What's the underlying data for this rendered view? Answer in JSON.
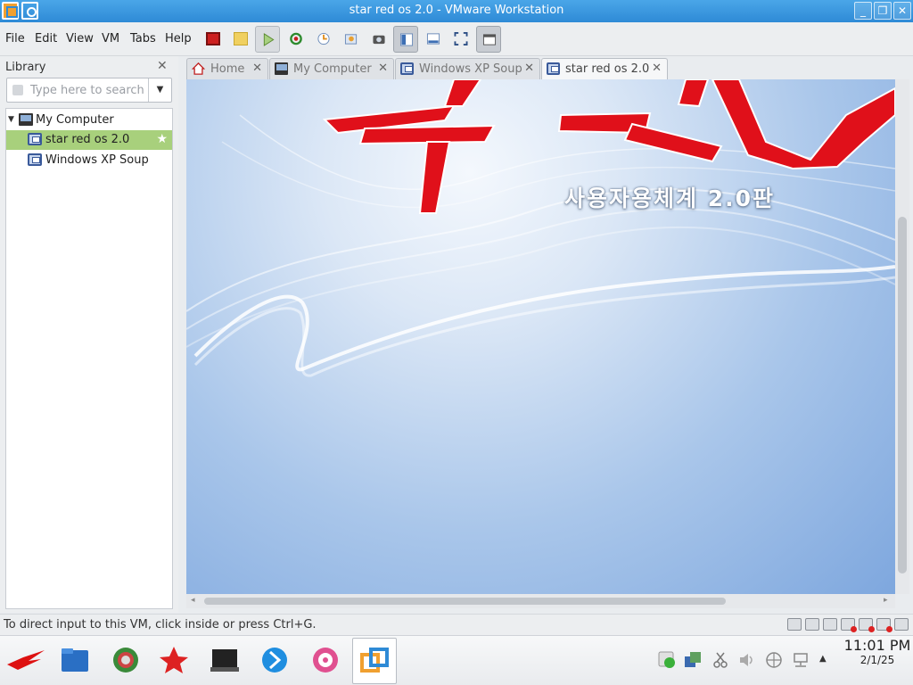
{
  "window": {
    "title": "star red os 2.0 - VMware Workstation"
  },
  "menu": [
    "File",
    "Edit",
    "View",
    "VM",
    "Tabs",
    "Help"
  ],
  "library": {
    "title": "Library",
    "search_placeholder": "Type here to search",
    "tree": [
      {
        "label": "My Computer",
        "icon": "computer-icon"
      },
      {
        "label": "star red os 2.0",
        "icon": "vm-icon",
        "selected": true
      },
      {
        "label": "Windows XP Soup",
        "icon": "vm-icon"
      }
    ]
  },
  "tabs": [
    {
      "label": "Home",
      "icon": "home-icon"
    },
    {
      "label": "My Computer",
      "icon": "computer-icon"
    },
    {
      "label": "Windows XP Soup",
      "icon": "vm-icon"
    },
    {
      "label": "star red os 2.0",
      "icon": "vm-icon",
      "active": true
    }
  ],
  "vm_screen": {
    "logo_text": "붉은별",
    "subtitle": "사용자용체계 2.0판"
  },
  "status": {
    "message": "To direct input to this VM, click inside or press Ctrl+G."
  },
  "clock": {
    "time": "11:01 PM",
    "date": "2/1/25"
  },
  "colors": {
    "titlebar": "#2e8ad6",
    "selected_row": "#a8d07c",
    "logo_red": "#e0101a"
  }
}
